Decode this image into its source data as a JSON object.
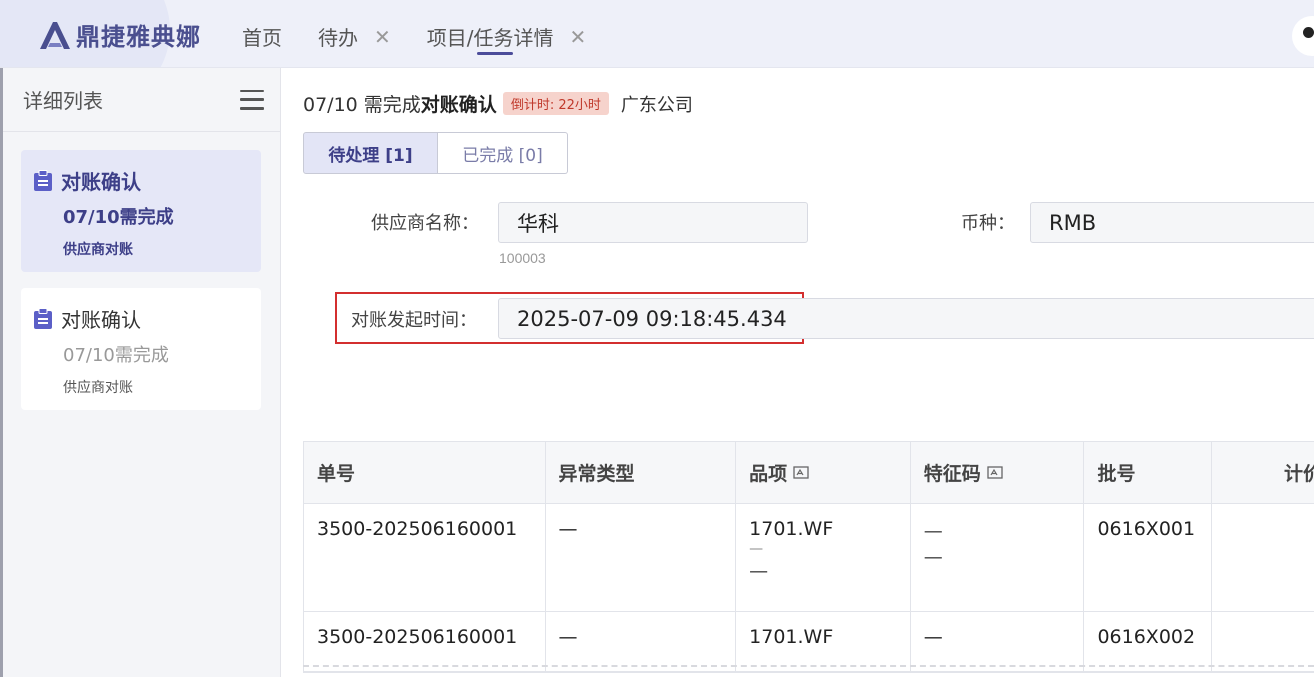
{
  "header": {
    "logo_text": "鼎捷雅典娜",
    "tabs": [
      {
        "label": "首页",
        "closable": false,
        "active": false
      },
      {
        "label": "待办",
        "closable": true,
        "active": false
      },
      {
        "label": "项目/任务详情",
        "closable": true,
        "active": true
      }
    ],
    "close_glyph": "✕"
  },
  "sidebar": {
    "title": "详细列表",
    "items": [
      {
        "title": "对账确认",
        "due": "07/10需完成",
        "type": "供应商对账",
        "active": true
      },
      {
        "title": "对账确认",
        "due": "07/10需完成",
        "type": "供应商对账",
        "active": false
      }
    ]
  },
  "task": {
    "date": "07/10 需完成",
    "name": "对账确认",
    "countdown": "倒计时: 22小时",
    "company": "广东公司"
  },
  "status_tabs": {
    "pending": "待处理 [1]",
    "done": "已完成 [0]"
  },
  "form": {
    "supplier_label": "供应商名称：",
    "supplier_value": "华科",
    "supplier_code": "100003",
    "currency_label": "币种：",
    "currency_value": "RMB",
    "start_time_label": "对账发起时间：",
    "start_time_value": "2025-07-09 09:18:45.434"
  },
  "table": {
    "headers": [
      "单号",
      "异常类型",
      "品项",
      "特征码",
      "批号",
      "计价"
    ],
    "rows": [
      {
        "order_no": "3500-202506160001",
        "exception": "—",
        "item": "1701.WF",
        "item_sub1": "—",
        "item_sub2": "—",
        "feature": "—",
        "feature_sub": "—",
        "batch": "0616X001"
      },
      {
        "order_no": "3500-202506160001",
        "exception": "—",
        "item": "1701.WF",
        "feature": "—",
        "batch": "0616X002"
      }
    ]
  },
  "colors": {
    "accent": "#3d3f88",
    "highlight_border": "#d32f2f",
    "countdown_bg": "#f6d3cc"
  }
}
